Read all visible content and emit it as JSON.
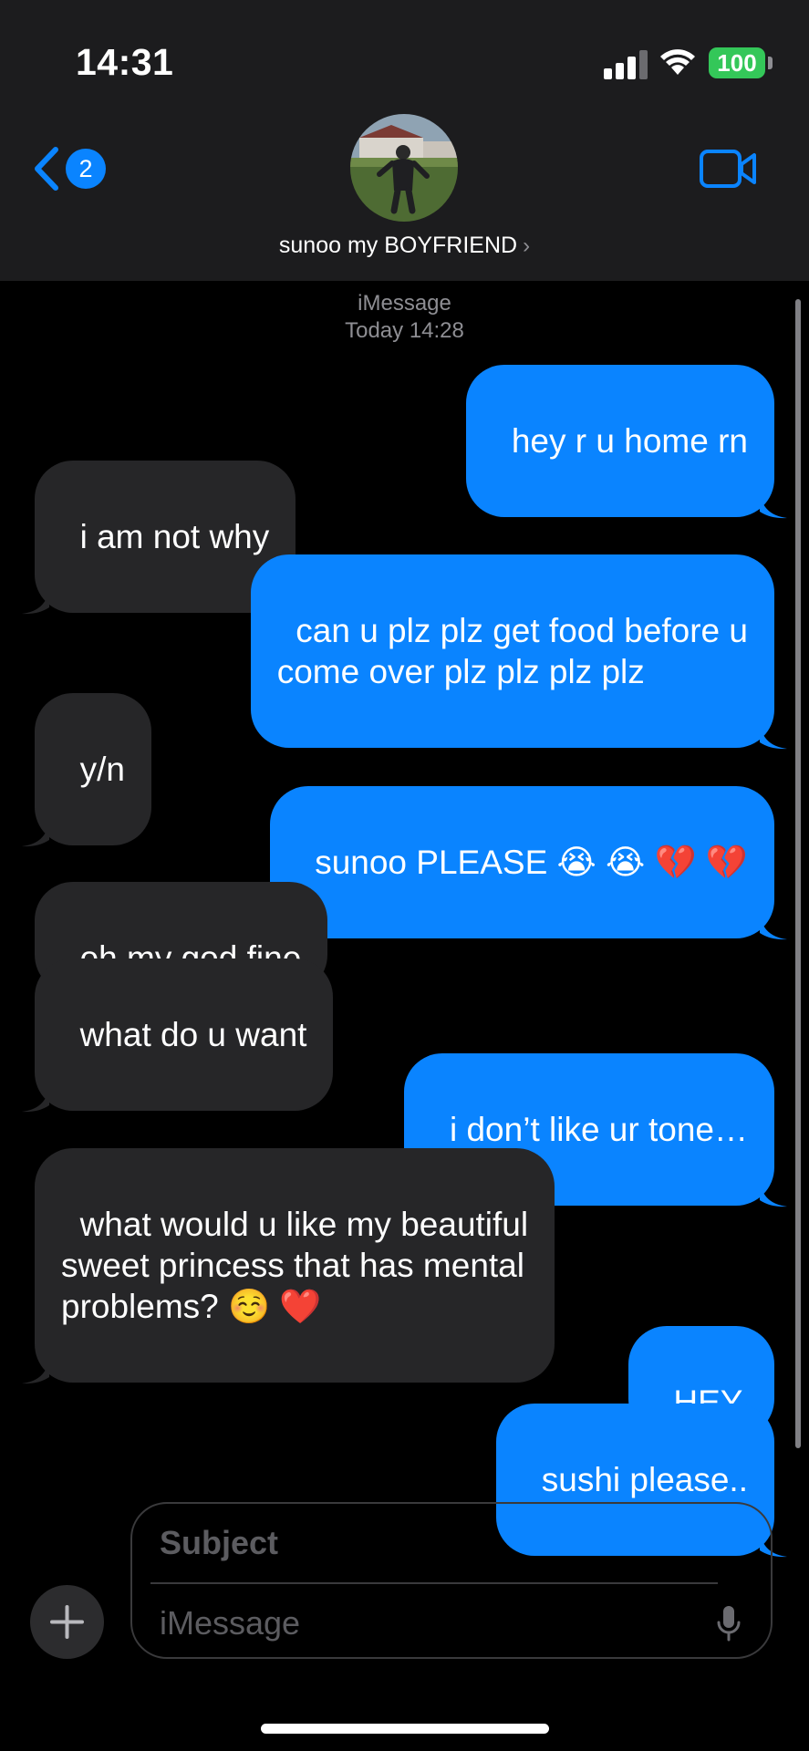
{
  "status_bar": {
    "time": "14:31",
    "battery": "100"
  },
  "header": {
    "back_count": "2",
    "contact_name": "sunoo my BOYFRIEND"
  },
  "thread": {
    "service": "iMessage",
    "timestamp": "Today 14:28"
  },
  "messages": [
    {
      "from": "me",
      "text": "hey r u home rn"
    },
    {
      "from": "them",
      "text": "i am not why"
    },
    {
      "from": "me",
      "text": "can u plz plz get food before u\ncome over plz plz plz plz"
    },
    {
      "from": "them",
      "text": "y/n"
    },
    {
      "from": "me",
      "text": "sunoo PLEASE 😭 😭 💔 💔"
    },
    {
      "from": "them",
      "text": "oh my god fine"
    },
    {
      "from": "them",
      "text": "what do u want"
    },
    {
      "from": "me",
      "text": "i don’t like ur tone…"
    },
    {
      "from": "them",
      "text": "what would u like my beautiful\nsweet princess that has mental\nproblems? ☺️ ❤️"
    },
    {
      "from": "me",
      "text": "HEY."
    },
    {
      "from": "me",
      "text": "sushi please.."
    }
  ],
  "composer": {
    "subject_placeholder": "Subject",
    "message_placeholder": "iMessage"
  },
  "colors": {
    "sent_bubble": "#0a84ff",
    "received_bubble": "#262628",
    "battery": "#34c759"
  },
  "icons": [
    "back-chevron-icon",
    "video-camera-icon",
    "plus-icon",
    "microphone-icon",
    "signal-icon",
    "wifi-icon"
  ]
}
